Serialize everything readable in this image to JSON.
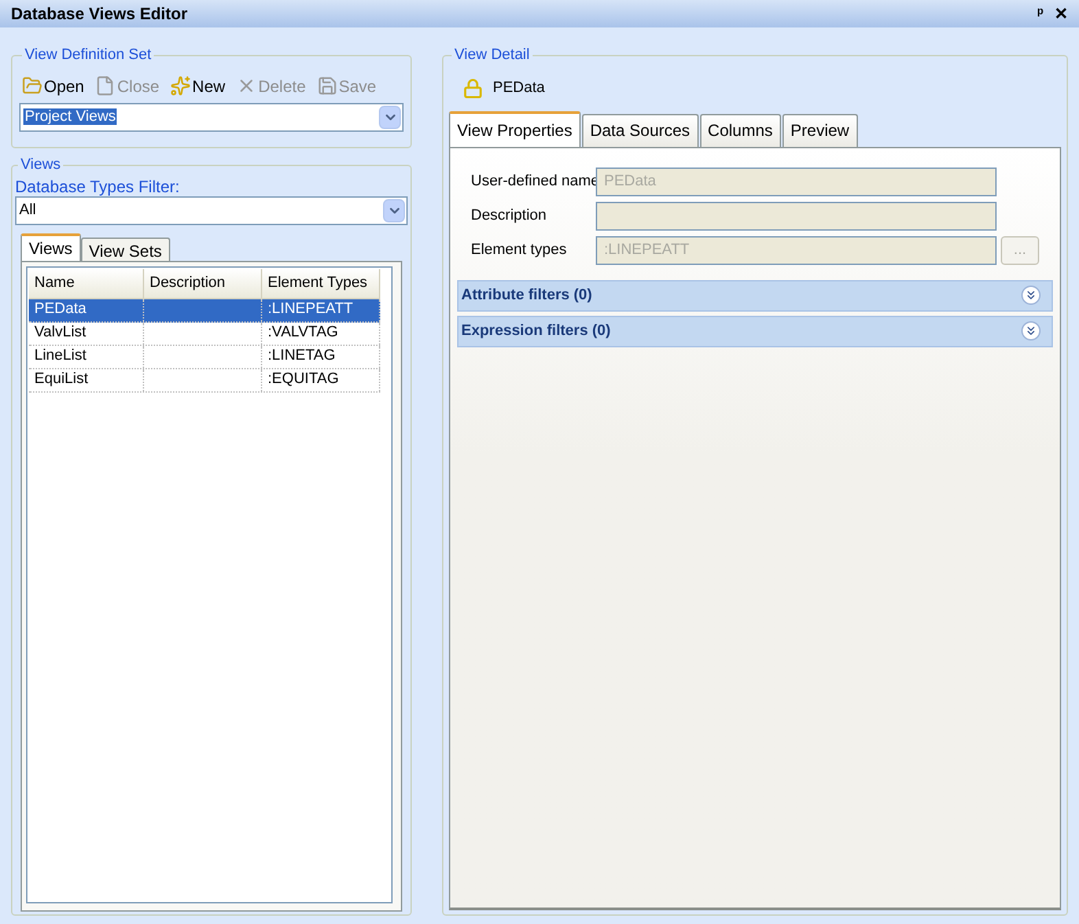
{
  "window": {
    "title": "Database Views Editor",
    "pin": "ᵖ",
    "close": "✕"
  },
  "view_definition_set": {
    "title": "View Definition Set",
    "toolbar": [
      {
        "kind": "open",
        "label": "Open",
        "disabled": false
      },
      {
        "kind": "close",
        "label": "Close",
        "disabled": true
      },
      {
        "kind": "new",
        "label": "New",
        "disabled": false
      },
      {
        "kind": "delete",
        "label": "Delete",
        "disabled": true
      },
      {
        "kind": "save",
        "label": "Save",
        "disabled": true
      }
    ],
    "set_dropdown": {
      "value": "Project Views"
    }
  },
  "views": {
    "title": "Views",
    "filter_label": "Database Types Filter:",
    "filter_dropdown": {
      "value": "All"
    },
    "tabs": [
      {
        "label": "Views",
        "selected": true
      },
      {
        "label": "View Sets",
        "selected": false
      }
    ],
    "table": {
      "columns": [
        "Name",
        "Description",
        "Element Types"
      ],
      "rows": [
        {
          "cells": [
            "PEData",
            "",
            ":LINEPEATT"
          ],
          "selected": true
        },
        {
          "cells": [
            "ValvList",
            "",
            ":VALVTAG"
          ],
          "selected": false
        },
        {
          "cells": [
            "LineList",
            "",
            ":LINETAG"
          ],
          "selected": false
        },
        {
          "cells": [
            "EquiList",
            "",
            ":EQUITAG"
          ],
          "selected": false
        }
      ]
    }
  },
  "view_detail": {
    "title": "View Detail",
    "view_name": "PEData",
    "tabs": [
      {
        "label": "View Properties",
        "selected": true
      },
      {
        "label": "Data Sources",
        "selected": false
      },
      {
        "label": "Columns",
        "selected": false
      },
      {
        "label": "Preview",
        "selected": false
      }
    ],
    "fields": [
      {
        "label": "User-defined name",
        "value": "PEData",
        "kind": "text",
        "disabled": true
      },
      {
        "label": "Description",
        "kind": "text",
        "disabled": true
      },
      {
        "label": "Element types",
        "value": ":LINEPEATT",
        "kind": "browse",
        "button": "...",
        "disabled": true
      }
    ],
    "sections": [
      {
        "title": "Attribute filters (0)",
        "expanded": false
      },
      {
        "title": "Expression filters (0)",
        "expanded": false
      }
    ]
  }
}
